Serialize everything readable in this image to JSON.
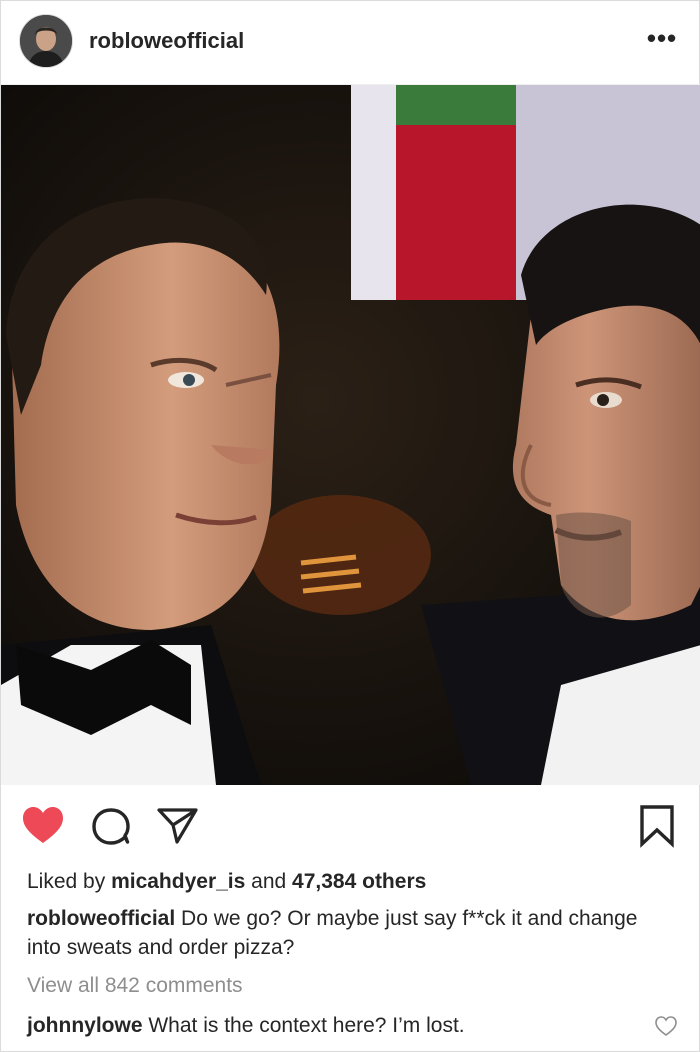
{
  "header": {
    "username": "robloweofficial",
    "more_label": "•••"
  },
  "post": {
    "photo_alt": "",
    "likes": {
      "prefix": "Liked by",
      "user": "micahdyer_is",
      "middle": "and",
      "count": "47,384 others"
    },
    "caption": {
      "username": "robloweofficial",
      "text": "Do we go? Or maybe just say f**ck it and change into sweats and order pizza?"
    },
    "view_all_comments": "View all 842 comments",
    "comments": [
      {
        "username": "johnnylowe",
        "text": "What is the context here? I’m lost."
      }
    ]
  },
  "icons": {
    "like": "heart-filled-icon",
    "comment": "speech-bubble-icon",
    "share": "paper-plane-icon",
    "save": "bookmark-icon",
    "comment_like": "heart-outline-icon",
    "more": "ellipsis-icon"
  },
  "colors": {
    "like_red": "#ed4956",
    "text": "#262626",
    "muted": "#8e8e8e"
  }
}
